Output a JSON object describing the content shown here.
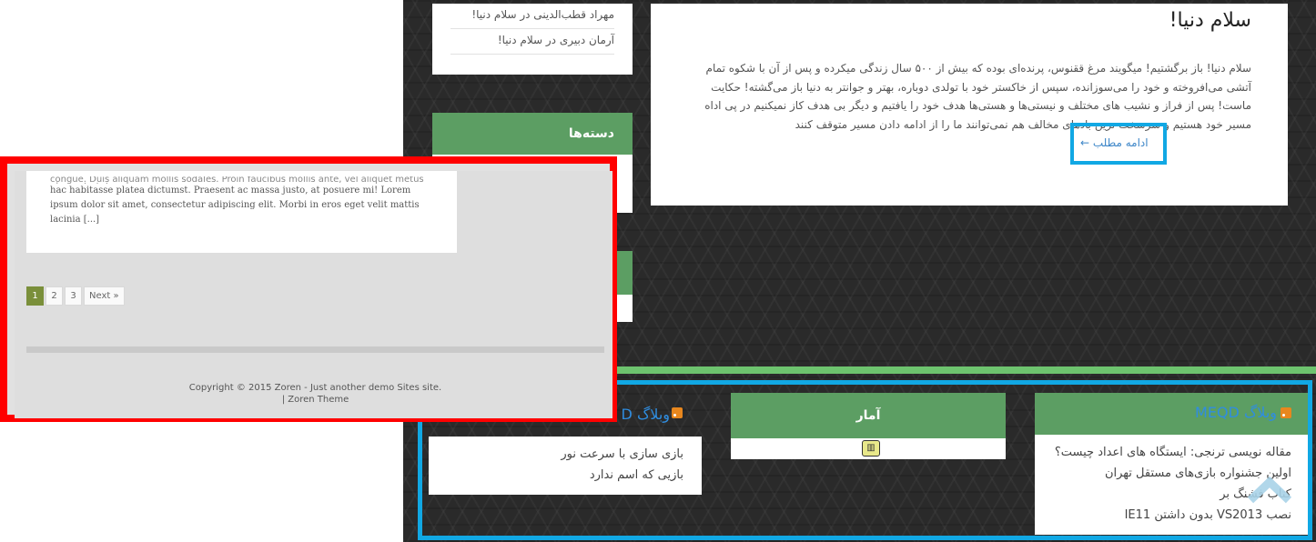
{
  "sidebar": {
    "recent_comments": [
      "مهراد قطب‌الدینی در سلام دنیا!",
      "آرمان دبیری در سلام دنیا!"
    ],
    "categories_title": "دسته‌ها"
  },
  "post": {
    "title": "سلام دنیا!",
    "body": "سلام دنیا! باز برگشتیم! میگویند مرغ ققنوس، پرنده‌ای بوده که بیش از ۵۰۰ سال زندگی میکرده و پس از آن با شکوه تمام آتشی می‌افروخته و خود را می‌سوزانده، سپس از خاکستر خود با تولدی دوباره، بهتر و جوانتر به دنیا باز می‌گشته! حکایت ماست! پس از فراز و نشیب های مختلف و نیستی‌ها و هستی‌ها هدف خود را یافتیم و دیگر بی هدف کاز نمیکنیم در پی اداه مسیر خود هستیم و سرسخت ترین بادهای مخالف هم نمی‌توانند ما را از ادامه دادن مسیر متوقف کنند",
    "read_more": "ادامه مطلب ←"
  },
  "footer_widgets": {
    "right": {
      "title": "وبلاگ MEQD",
      "items": [
        "مقاله نویسی ترنجی: ایستگاه های اعداد چیست؟",
        "اولین جشنواره بازی‌های مستقل تهران",
        "کتاب فشنگ بر",
        "نصب VS2013 بدون داشتن IE11"
      ]
    },
    "middle": {
      "title": "آمار",
      "stats_icon": "bar-chart-icon"
    },
    "left": {
      "title": "وبلاگ D",
      "items": [
        "بازی سازی با سرعت نور",
        "بازیی که اسم ندارد"
      ]
    }
  },
  "overlay": {
    "excerpt_cut": "congue. Duis aliquam mollis sodales. Proin faucibus mollis ante, vel aliquet metus placerat ut. In",
    "excerpt": "hac habitasse platea dictumst. Praesent ac massa justo, at posuere mi! Lorem ipsum dolor sit amet, consectetur adipiscing elit. Morbi in eros eget velit mattis lacinia [...]",
    "pagination": [
      "1",
      "2",
      "3",
      "Next »"
    ],
    "copyright_line1": "Copyright © 2015 Zoren - Just another demo Sites site.",
    "copyright_line2": "| Zoren Theme"
  },
  "colors": {
    "widget_green": "#5c9e63",
    "highlight_blue": "#11a8e4",
    "highlight_red": "#ff0000",
    "link_blue": "#3d86c8"
  }
}
